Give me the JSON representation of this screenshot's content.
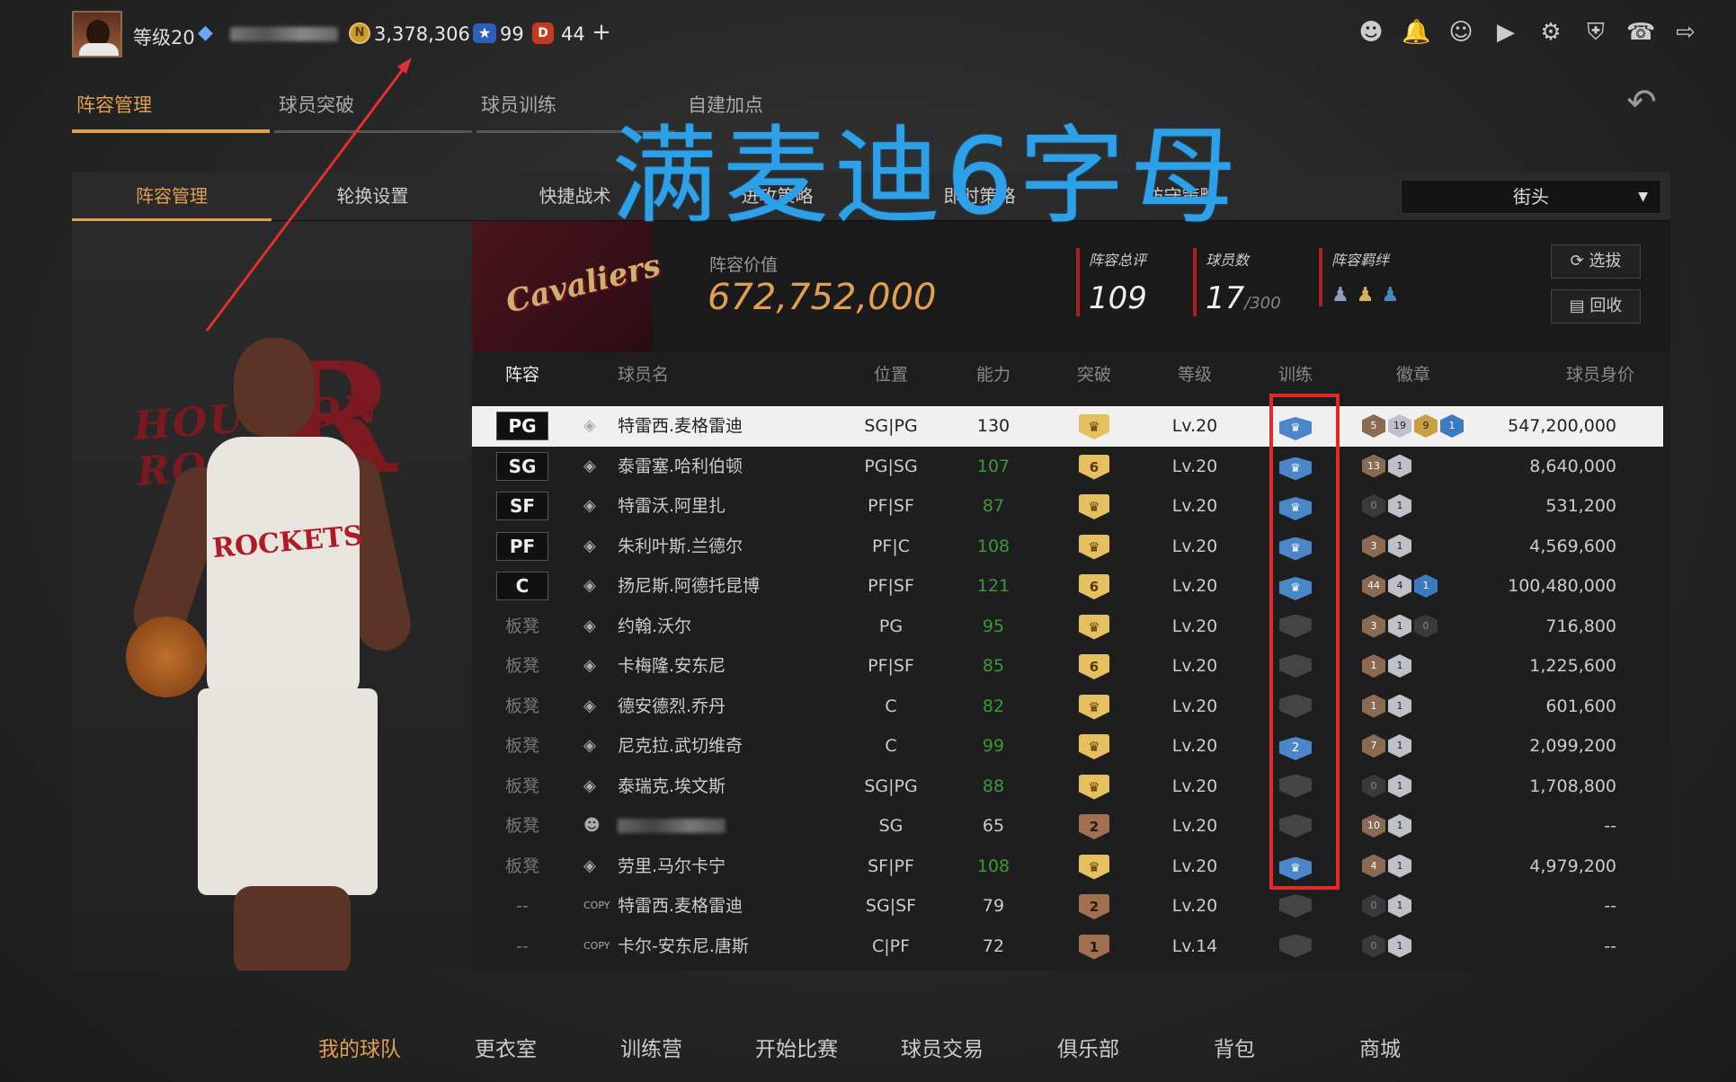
{
  "topbar": {
    "level_label": "等级20",
    "coins": "3,378,306",
    "stars": "99",
    "gems": "44",
    "coin_symbol": "N",
    "gem_symbol": "D",
    "plus_label": "+",
    "icons": [
      "user-icon",
      "bell-icon",
      "friends-icon",
      "video-icon",
      "gear-icon",
      "shield-icon",
      "headset-icon",
      "logout-icon"
    ]
  },
  "main_tabs": [
    "阵容管理",
    "球员突破",
    "球员训练",
    "自建加点"
  ],
  "sub_tabs": [
    "阵容管理",
    "轮换设置",
    "快捷战术",
    "进攻策略",
    "即时策略",
    "防守策略"
  ],
  "dropdown": {
    "value": "街头"
  },
  "overlay_text": "满麦迪6字母",
  "team": {
    "value_label": "阵容价值",
    "value": "672,752,000",
    "rating_label": "阵容总评",
    "rating": "109",
    "players_label": "球员数",
    "players": "17",
    "players_max": "/300",
    "bond_label": "阵容羁绊",
    "select_btn": "选拔",
    "recycle_btn": "回收"
  },
  "table": {
    "headers": [
      "阵容",
      "球员名",
      "位置",
      "能力",
      "突破",
      "等级",
      "训练",
      "徽章",
      "球员身价"
    ],
    "rows": [
      {
        "slot": "PG",
        "name": "特雷西.麦格雷迪",
        "pos": "SG|PG",
        "ability": "130",
        "break": "crown",
        "level": "Lv.20",
        "train": "on",
        "badges": [
          [
            "bronze",
            "5"
          ],
          [
            "silver",
            "19"
          ],
          [
            "gold",
            "9"
          ],
          [
            "blue",
            "1"
          ]
        ],
        "price": "547,200,000",
        "selected": true,
        "icon": "04"
      },
      {
        "slot": "SG",
        "name": "泰雷塞.哈利伯顿",
        "pos": "PG|SG",
        "ability": "107",
        "break": "6",
        "level": "Lv.20",
        "train": "on",
        "badges": [
          [
            "bronze",
            "13"
          ],
          [
            "silver",
            "1"
          ]
        ],
        "price": "8,640,000"
      },
      {
        "slot": "SF",
        "name": "特雷沃.阿里扎",
        "pos": "PF|SF",
        "ability": "87",
        "break": "crown",
        "level": "Lv.20",
        "train": "on",
        "badges": [
          [
            "dark",
            "0"
          ],
          [
            "silver",
            "1"
          ]
        ],
        "price": "531,200"
      },
      {
        "slot": "PF",
        "name": "朱利叶斯.兰德尔",
        "pos": "PF|C",
        "ability": "108",
        "break": "crown",
        "level": "Lv.20",
        "train": "on",
        "badges": [
          [
            "bronze",
            "3"
          ],
          [
            "silver",
            "1"
          ]
        ],
        "price": "4,569,600"
      },
      {
        "slot": "C",
        "name": "扬尼斯.阿德托昆博",
        "pos": "PF|SF",
        "ability": "121",
        "break": "6",
        "level": "Lv.20",
        "train": "on",
        "badges": [
          [
            "bronze",
            "44"
          ],
          [
            "silver",
            "4"
          ],
          [
            "blue",
            "1"
          ]
        ],
        "price": "100,480,000"
      },
      {
        "slot": "板凳",
        "name": "约翰.沃尔",
        "pos": "PG",
        "ability": "95",
        "break": "crown",
        "level": "Lv.20",
        "train": "off",
        "badges": [
          [
            "bronze",
            "3"
          ],
          [
            "silver",
            "1"
          ],
          [
            "dark",
            "0"
          ]
        ],
        "price": "716,800"
      },
      {
        "slot": "板凳",
        "name": "卡梅隆.安东尼",
        "pos": "PF|SF",
        "ability": "85",
        "break": "6",
        "level": "Lv.20",
        "train": "off",
        "badges": [
          [
            "bronze",
            "1"
          ],
          [
            "silver",
            "1"
          ]
        ],
        "price": "1,225,600"
      },
      {
        "slot": "板凳",
        "name": "德安德烈.乔丹",
        "pos": "C",
        "ability": "82",
        "break": "crown",
        "level": "Lv.20",
        "train": "off",
        "badges": [
          [
            "bronze",
            "1"
          ],
          [
            "silver",
            "1"
          ]
        ],
        "price": "601,600"
      },
      {
        "slot": "板凳",
        "name": "尼克拉.武切维奇",
        "pos": "C",
        "ability": "99",
        "break": "crown",
        "level": "Lv.20",
        "train": "2",
        "badges": [
          [
            "bronze",
            "7"
          ],
          [
            "silver",
            "1"
          ]
        ],
        "price": "2,099,200"
      },
      {
        "slot": "板凳",
        "name": "泰瑞克.埃文斯",
        "pos": "SG|PG",
        "ability": "88",
        "break": "crown",
        "level": "Lv.20",
        "train": "off",
        "badges": [
          [
            "dark",
            "0"
          ],
          [
            "silver",
            "1"
          ]
        ],
        "price": "1,708,800"
      },
      {
        "slot": "板凳",
        "name": "",
        "pos": "SG",
        "ability": "65",
        "break": "2",
        "level": "Lv.20",
        "train": "off",
        "badges": [
          [
            "bronze",
            "10"
          ],
          [
            "silver",
            "1"
          ]
        ],
        "price": "--",
        "blurred": true
      },
      {
        "slot": "板凳",
        "name": "劳里.马尔卡宁",
        "pos": "SF|PF",
        "ability": "108",
        "break": "crown",
        "level": "Lv.20",
        "train": "on",
        "badges": [
          [
            "bronze",
            "4"
          ],
          [
            "silver",
            "1"
          ]
        ],
        "price": "4,979,200"
      },
      {
        "slot": "--",
        "name": "特雷西.麦格雷迪",
        "pos": "SG|SF",
        "ability": "79",
        "break": "2",
        "level": "Lv.20",
        "train": "off",
        "badges": [
          [
            "dark",
            "0"
          ],
          [
            "silver",
            "1"
          ]
        ],
        "price": "--",
        "copy": true
      },
      {
        "slot": "--",
        "name": "卡尔-安东尼.唐斯",
        "pos": "C|PF",
        "ability": "72",
        "break": "1",
        "level": "Lv.14",
        "train": "off",
        "badges": [
          [
            "dark",
            "0"
          ],
          [
            "silver",
            "1"
          ]
        ],
        "price": "--",
        "copy": true
      }
    ]
  },
  "bottom_nav": [
    "我的球队",
    "更衣室",
    "训练营",
    "开始比赛",
    "球员交易",
    "俱乐部",
    "背包",
    "商城"
  ]
}
